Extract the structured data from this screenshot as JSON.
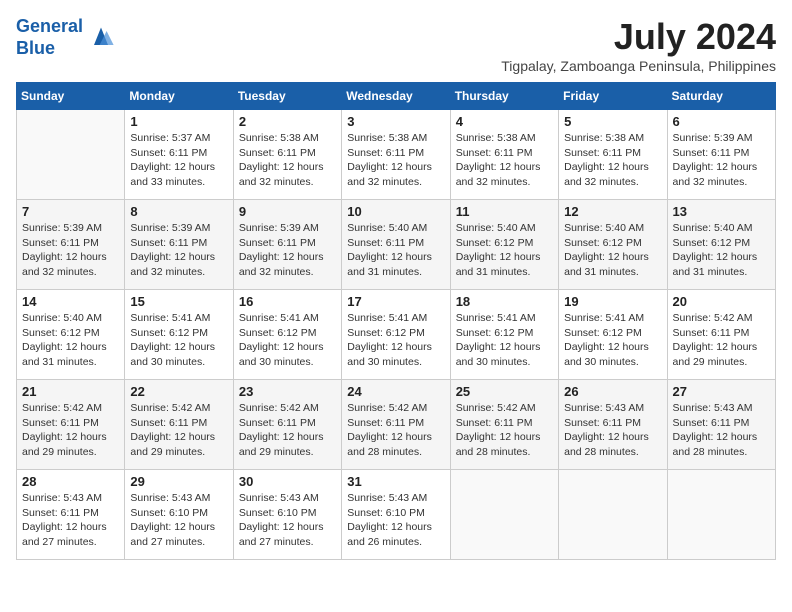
{
  "header": {
    "logo_line1": "General",
    "logo_line2": "Blue",
    "month_title": "July 2024",
    "location": "Tigpalay, Zamboanga Peninsula, Philippines"
  },
  "days_of_week": [
    "Sunday",
    "Monday",
    "Tuesday",
    "Wednesday",
    "Thursday",
    "Friday",
    "Saturday"
  ],
  "weeks": [
    [
      {
        "num": "",
        "info": ""
      },
      {
        "num": "1",
        "info": "Sunrise: 5:37 AM\nSunset: 6:11 PM\nDaylight: 12 hours\nand 33 minutes."
      },
      {
        "num": "2",
        "info": "Sunrise: 5:38 AM\nSunset: 6:11 PM\nDaylight: 12 hours\nand 32 minutes."
      },
      {
        "num": "3",
        "info": "Sunrise: 5:38 AM\nSunset: 6:11 PM\nDaylight: 12 hours\nand 32 minutes."
      },
      {
        "num": "4",
        "info": "Sunrise: 5:38 AM\nSunset: 6:11 PM\nDaylight: 12 hours\nand 32 minutes."
      },
      {
        "num": "5",
        "info": "Sunrise: 5:38 AM\nSunset: 6:11 PM\nDaylight: 12 hours\nand 32 minutes."
      },
      {
        "num": "6",
        "info": "Sunrise: 5:39 AM\nSunset: 6:11 PM\nDaylight: 12 hours\nand 32 minutes."
      }
    ],
    [
      {
        "num": "7",
        "info": "Sunrise: 5:39 AM\nSunset: 6:11 PM\nDaylight: 12 hours\nand 32 minutes."
      },
      {
        "num": "8",
        "info": "Sunrise: 5:39 AM\nSunset: 6:11 PM\nDaylight: 12 hours\nand 32 minutes."
      },
      {
        "num": "9",
        "info": "Sunrise: 5:39 AM\nSunset: 6:11 PM\nDaylight: 12 hours\nand 32 minutes."
      },
      {
        "num": "10",
        "info": "Sunrise: 5:40 AM\nSunset: 6:11 PM\nDaylight: 12 hours\nand 31 minutes."
      },
      {
        "num": "11",
        "info": "Sunrise: 5:40 AM\nSunset: 6:12 PM\nDaylight: 12 hours\nand 31 minutes."
      },
      {
        "num": "12",
        "info": "Sunrise: 5:40 AM\nSunset: 6:12 PM\nDaylight: 12 hours\nand 31 minutes."
      },
      {
        "num": "13",
        "info": "Sunrise: 5:40 AM\nSunset: 6:12 PM\nDaylight: 12 hours\nand 31 minutes."
      }
    ],
    [
      {
        "num": "14",
        "info": "Sunrise: 5:40 AM\nSunset: 6:12 PM\nDaylight: 12 hours\nand 31 minutes."
      },
      {
        "num": "15",
        "info": "Sunrise: 5:41 AM\nSunset: 6:12 PM\nDaylight: 12 hours\nand 30 minutes."
      },
      {
        "num": "16",
        "info": "Sunrise: 5:41 AM\nSunset: 6:12 PM\nDaylight: 12 hours\nand 30 minutes."
      },
      {
        "num": "17",
        "info": "Sunrise: 5:41 AM\nSunset: 6:12 PM\nDaylight: 12 hours\nand 30 minutes."
      },
      {
        "num": "18",
        "info": "Sunrise: 5:41 AM\nSunset: 6:12 PM\nDaylight: 12 hours\nand 30 minutes."
      },
      {
        "num": "19",
        "info": "Sunrise: 5:41 AM\nSunset: 6:12 PM\nDaylight: 12 hours\nand 30 minutes."
      },
      {
        "num": "20",
        "info": "Sunrise: 5:42 AM\nSunset: 6:11 PM\nDaylight: 12 hours\nand 29 minutes."
      }
    ],
    [
      {
        "num": "21",
        "info": "Sunrise: 5:42 AM\nSunset: 6:11 PM\nDaylight: 12 hours\nand 29 minutes."
      },
      {
        "num": "22",
        "info": "Sunrise: 5:42 AM\nSunset: 6:11 PM\nDaylight: 12 hours\nand 29 minutes."
      },
      {
        "num": "23",
        "info": "Sunrise: 5:42 AM\nSunset: 6:11 PM\nDaylight: 12 hours\nand 29 minutes."
      },
      {
        "num": "24",
        "info": "Sunrise: 5:42 AM\nSunset: 6:11 PM\nDaylight: 12 hours\nand 28 minutes."
      },
      {
        "num": "25",
        "info": "Sunrise: 5:42 AM\nSunset: 6:11 PM\nDaylight: 12 hours\nand 28 minutes."
      },
      {
        "num": "26",
        "info": "Sunrise: 5:43 AM\nSunset: 6:11 PM\nDaylight: 12 hours\nand 28 minutes."
      },
      {
        "num": "27",
        "info": "Sunrise: 5:43 AM\nSunset: 6:11 PM\nDaylight: 12 hours\nand 28 minutes."
      }
    ],
    [
      {
        "num": "28",
        "info": "Sunrise: 5:43 AM\nSunset: 6:11 PM\nDaylight: 12 hours\nand 27 minutes."
      },
      {
        "num": "29",
        "info": "Sunrise: 5:43 AM\nSunset: 6:10 PM\nDaylight: 12 hours\nand 27 minutes."
      },
      {
        "num": "30",
        "info": "Sunrise: 5:43 AM\nSunset: 6:10 PM\nDaylight: 12 hours\nand 27 minutes."
      },
      {
        "num": "31",
        "info": "Sunrise: 5:43 AM\nSunset: 6:10 PM\nDaylight: 12 hours\nand 26 minutes."
      },
      {
        "num": "",
        "info": ""
      },
      {
        "num": "",
        "info": ""
      },
      {
        "num": "",
        "info": ""
      }
    ]
  ]
}
